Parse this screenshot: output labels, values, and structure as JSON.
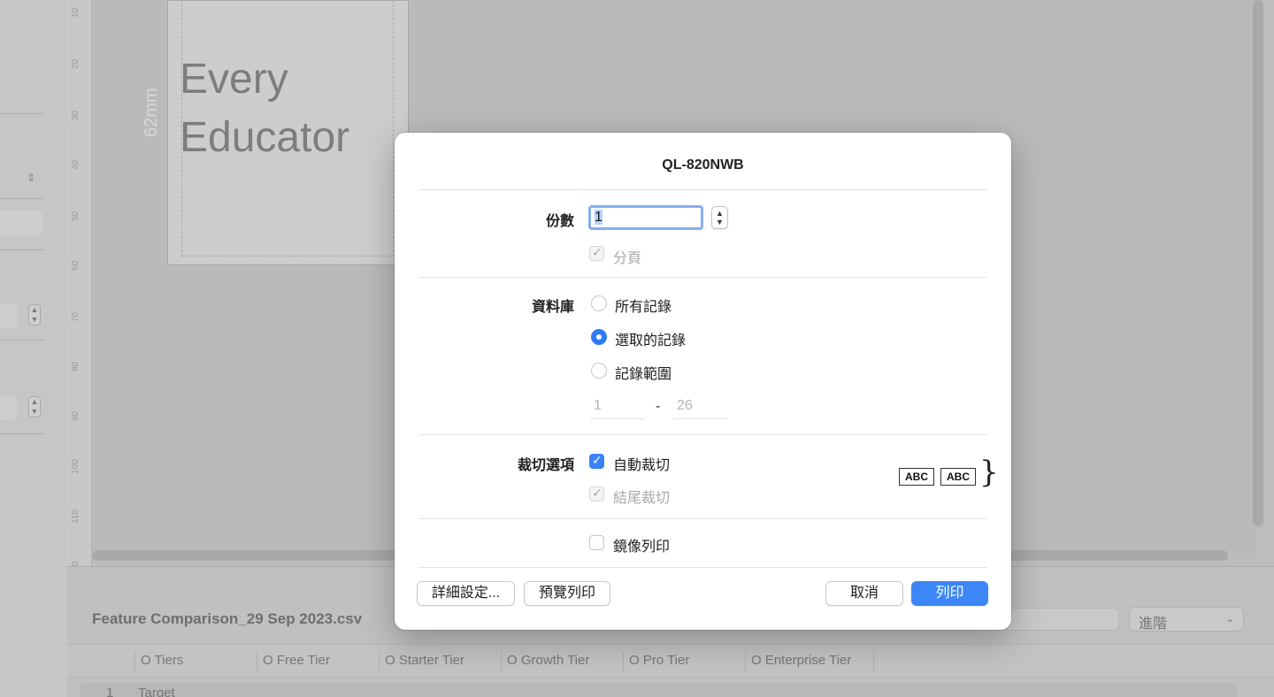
{
  "background": {
    "file_title": "Feature Comparison_29 Sep 2023.csv",
    "advanced_select": "進階",
    "columns": [
      "O Tiers",
      "O Free Tier",
      "O Starter Tier",
      "O Growth Tier",
      "O Pro Tier",
      "O Enterprise Tier"
    ],
    "rows": [
      {
        "num": "1",
        "text": "Target"
      }
    ],
    "label_preview": {
      "line1": "Every",
      "line2": "Educator",
      "size_label": "62mm"
    },
    "ruler_labels": [
      "10",
      "20",
      "30",
      "40",
      "50",
      "60",
      "70",
      "80",
      "90",
      "100",
      "110",
      "0"
    ]
  },
  "dialog": {
    "title": "QL-820NWB",
    "copies": {
      "label": "份數",
      "value": "1"
    },
    "collate": {
      "label": "分頁",
      "checked": true,
      "disabled": true
    },
    "database": {
      "label": "資料庫",
      "options": [
        {
          "label": "所有記錄",
          "selected": false
        },
        {
          "label": "選取的記錄",
          "selected": true
        },
        {
          "label": "記錄範圍",
          "selected": false
        }
      ],
      "range_from": "1",
      "range_dash": "-",
      "range_to": "26"
    },
    "cut_options": {
      "label": "裁切選項",
      "auto_cut": {
        "label": "自動裁切",
        "checked": true
      },
      "cut_at_end": {
        "label": "結尾裁切",
        "checked": true,
        "disabled": true
      },
      "illustration": [
        "ABC",
        "ABC"
      ]
    },
    "mirror_print": {
      "label": "鏡像列印",
      "checked": false
    },
    "buttons": {
      "details": "詳細設定...",
      "preview": "預覽列印",
      "cancel": "取消",
      "print": "列印"
    },
    "accent_color": "#3d86f7"
  }
}
